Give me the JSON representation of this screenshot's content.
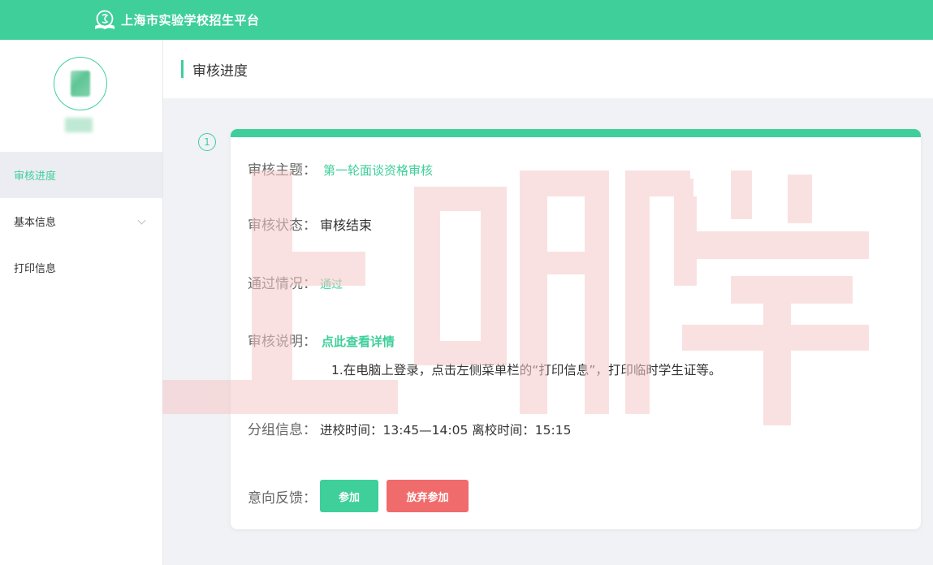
{
  "app": {
    "title": "上海市实验学校招生平台"
  },
  "sidebar": {
    "items": [
      {
        "label": "审核进度",
        "active": true
      },
      {
        "label": "基本信息",
        "has_submenu": true
      },
      {
        "label": "打印信息"
      }
    ]
  },
  "page": {
    "title": "审核进度"
  },
  "step": {
    "number": "1"
  },
  "review": {
    "topic_label": "审核主题：",
    "topic_value": "第一轮面谈资格审核",
    "status_label": "审核状态：",
    "status_value": "审核结束",
    "pass_label": "通过情况：",
    "pass_value": "通过",
    "desc_label": "审核说明：",
    "desc_link": "点此查看详情",
    "desc_note": "1.在电脑上登录，点击左侧菜单栏的“打印信息”，打印临时学生证等。",
    "group_label": "分组信息：",
    "group_value": "进校时间：13:45—14:05 离校时间：15:15",
    "feedback_label": "意向反馈：",
    "join_button": "参加",
    "quit_button": "放弃参加"
  },
  "watermark": {
    "text": "上哪学"
  },
  "colors": {
    "accent": "#3ecf9b",
    "danger": "#f06b6b",
    "watermark": "#f6c9c9"
  }
}
